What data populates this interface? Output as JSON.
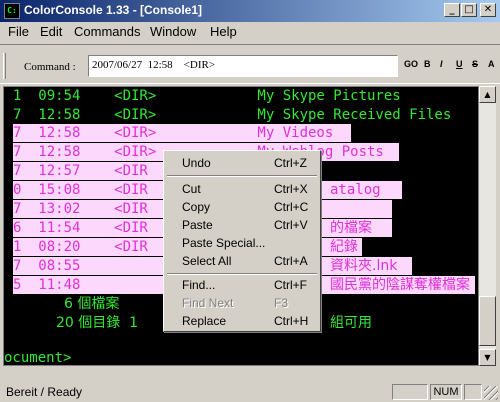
{
  "window": {
    "title": "ColorConsole 1.33 - [Console1]",
    "app_icon": "console-app-icon",
    "controls": {
      "minimize": "_",
      "maximize": "□",
      "close": "✕"
    }
  },
  "menubar": {
    "items": [
      "File",
      "Edit",
      "Commands",
      "Window",
      "Help"
    ]
  },
  "commandbar": {
    "label": "Command :",
    "value": "2007/06/27  12:58    <DIR>",
    "buttons": [
      "GO",
      "B",
      "I",
      "U",
      "S",
      "A"
    ]
  },
  "console": {
    "lines": [
      {
        "text": "1  09:54    <DIR>            My Skype Pictures",
        "color": "green"
      },
      {
        "text": "7  12:58    <DIR>            My Skype Received Files",
        "color": "green"
      },
      {
        "text": "7  12:58    <DIR>            My Videos",
        "color": "pink"
      },
      {
        "text": "7  12:58    <DIR>            My Weblog Posts",
        "color": "pink"
      },
      {
        "text": "7  12:57    <DIR",
        "color": "pink"
      },
      {
        "text": "0  15:08    <DIR",
        "color": "pink"
      },
      {
        "text": "7  13:02    <DIR",
        "color": "pink"
      },
      {
        "text": "6  11:54    <DIR",
        "color": "pink"
      },
      {
        "text": "1  08:20    <DIR",
        "color": "pink"
      },
      {
        "text": "7  08:55",
        "color": "pink"
      },
      {
        "text": "5  11:48",
        "color": "pink"
      }
    ],
    "right_fragments": [
      {
        "text": "atalog",
        "color": "pink"
      },
      {
        "text": "的檔案",
        "color": "pink"
      },
      {
        "text": "紀錄",
        "color": "pink"
      },
      {
        "text": "資料夾.lnk",
        "color": "pink"
      },
      {
        "text": "國民黨的陰謀奪權檔案",
        "color": "pink"
      }
    ],
    "stats": [
      "6 個檔案",
      "20 個目錄  1"
    ],
    "stats_right": "組可用",
    "prompt": "ocument>"
  },
  "context_menu": {
    "items": [
      {
        "label": "Undo",
        "shortcut": "Ctrl+Z",
        "enabled": true
      },
      {
        "separator": true
      },
      {
        "label": "Cut",
        "shortcut": "Ctrl+X",
        "enabled": true
      },
      {
        "label": "Copy",
        "shortcut": "Ctrl+C",
        "enabled": true
      },
      {
        "label": "Paste",
        "shortcut": "Ctrl+V",
        "enabled": true
      },
      {
        "label": "Paste Special...",
        "shortcut": "",
        "enabled": true
      },
      {
        "label": "Select All",
        "shortcut": "Ctrl+A",
        "enabled": true
      },
      {
        "separator": true
      },
      {
        "label": "Find...",
        "shortcut": "Ctrl+F",
        "enabled": true
      },
      {
        "label": "Find Next",
        "shortcut": "F3",
        "enabled": false
      },
      {
        "label": "Replace",
        "shortcut": "Ctrl+H",
        "enabled": true
      }
    ]
  },
  "statusbar": {
    "text": "Bereit / Ready",
    "indicators": [
      "NUM"
    ]
  },
  "colors": {
    "console_bg": "#000000",
    "green_text": "#33e833",
    "pink_text": "#e030d8",
    "selection_band": "#fcd8fc",
    "titlebar_start": "#0a246a",
    "titlebar_end": "#a6caf0"
  }
}
